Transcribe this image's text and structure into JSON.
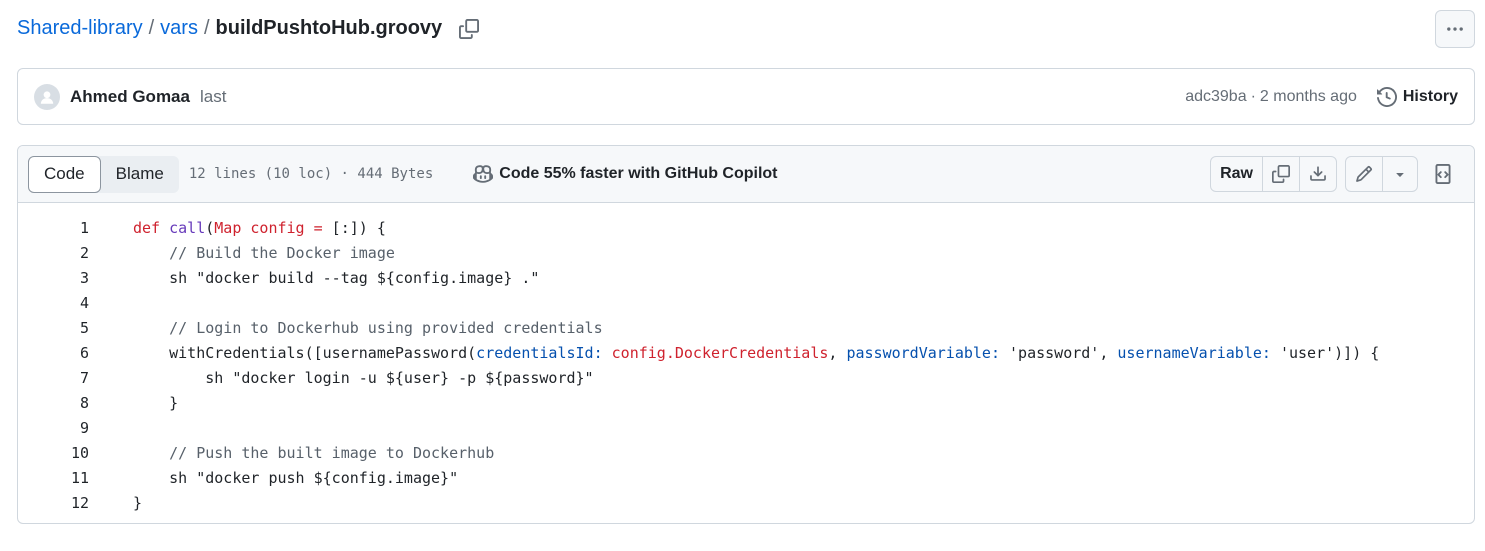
{
  "breadcrumb": {
    "repo": "Shared-library",
    "folder": "vars",
    "file": "buildPushtoHub.groovy",
    "separator": "/"
  },
  "commit": {
    "author": "Ahmed Gomaa",
    "message": "last",
    "hash": "adc39ba",
    "dot": "·",
    "time": "2 months ago",
    "history_label": "History"
  },
  "file_header": {
    "tabs": [
      {
        "label": "Code",
        "active": true
      },
      {
        "label": "Blame",
        "active": false
      }
    ],
    "info": "12 lines (10 loc) · 444 Bytes",
    "copilot_label": "Code 55% faster with GitHub Copilot",
    "raw_label": "Raw"
  },
  "code_lines": [
    {
      "n": "1"
    },
    {
      "n": "2"
    },
    {
      "n": "3"
    },
    {
      "n": "4"
    },
    {
      "n": "5"
    },
    {
      "n": "6"
    },
    {
      "n": "7"
    },
    {
      "n": "8"
    },
    {
      "n": "9"
    },
    {
      "n": "10"
    },
    {
      "n": "11"
    },
    {
      "n": "12"
    }
  ],
  "code": {
    "l1": {
      "t1": "def",
      "t2": " ",
      "t3": "call",
      "t4": "(",
      "t5": "Map config",
      "t6": " ",
      "t7": "=",
      "t8": " [:]) {"
    },
    "l2": {
      "t1": "    // Build the Docker image"
    },
    "l3": {
      "t1": "    sh \"docker build --tag ${config.image} .\""
    },
    "l4": {
      "t1": ""
    },
    "l5": {
      "t1": "    // Login to Dockerhub using provided credentials"
    },
    "l6": {
      "t1": "    withCredentials([usernamePassword(",
      "t2": "credentialsId:",
      "t3": " ",
      "t4": "config.DockerCredentials",
      "t5": ", ",
      "t6": "passwordVariable:",
      "t7": " 'password', ",
      "t8": "usernameVariable:",
      "t9": " 'user')]) {"
    },
    "l7": {
      "t1": "        sh \"docker login -u ${user} -p ${password}\""
    },
    "l8": {
      "t1": "    }"
    },
    "l9": {
      "t1": ""
    },
    "l10": {
      "t1": "    // Push the built image to Dockerhub"
    },
    "l11": {
      "t1": "    sh \"docker push ${config.image}\""
    },
    "l12": {
      "t1": "}"
    }
  },
  "colors": {
    "link": "#0969da",
    "keyword": "#cf222e",
    "function": "#6639ba",
    "comment": "#57606a",
    "property": "#0550ae"
  },
  "icons": [
    "copy-icon",
    "kebab-icon",
    "avatar-icon",
    "history-icon",
    "copilot-icon",
    "copy-icon",
    "download-icon",
    "pencil-icon",
    "triangle-down-icon",
    "symbols-icon"
  ]
}
